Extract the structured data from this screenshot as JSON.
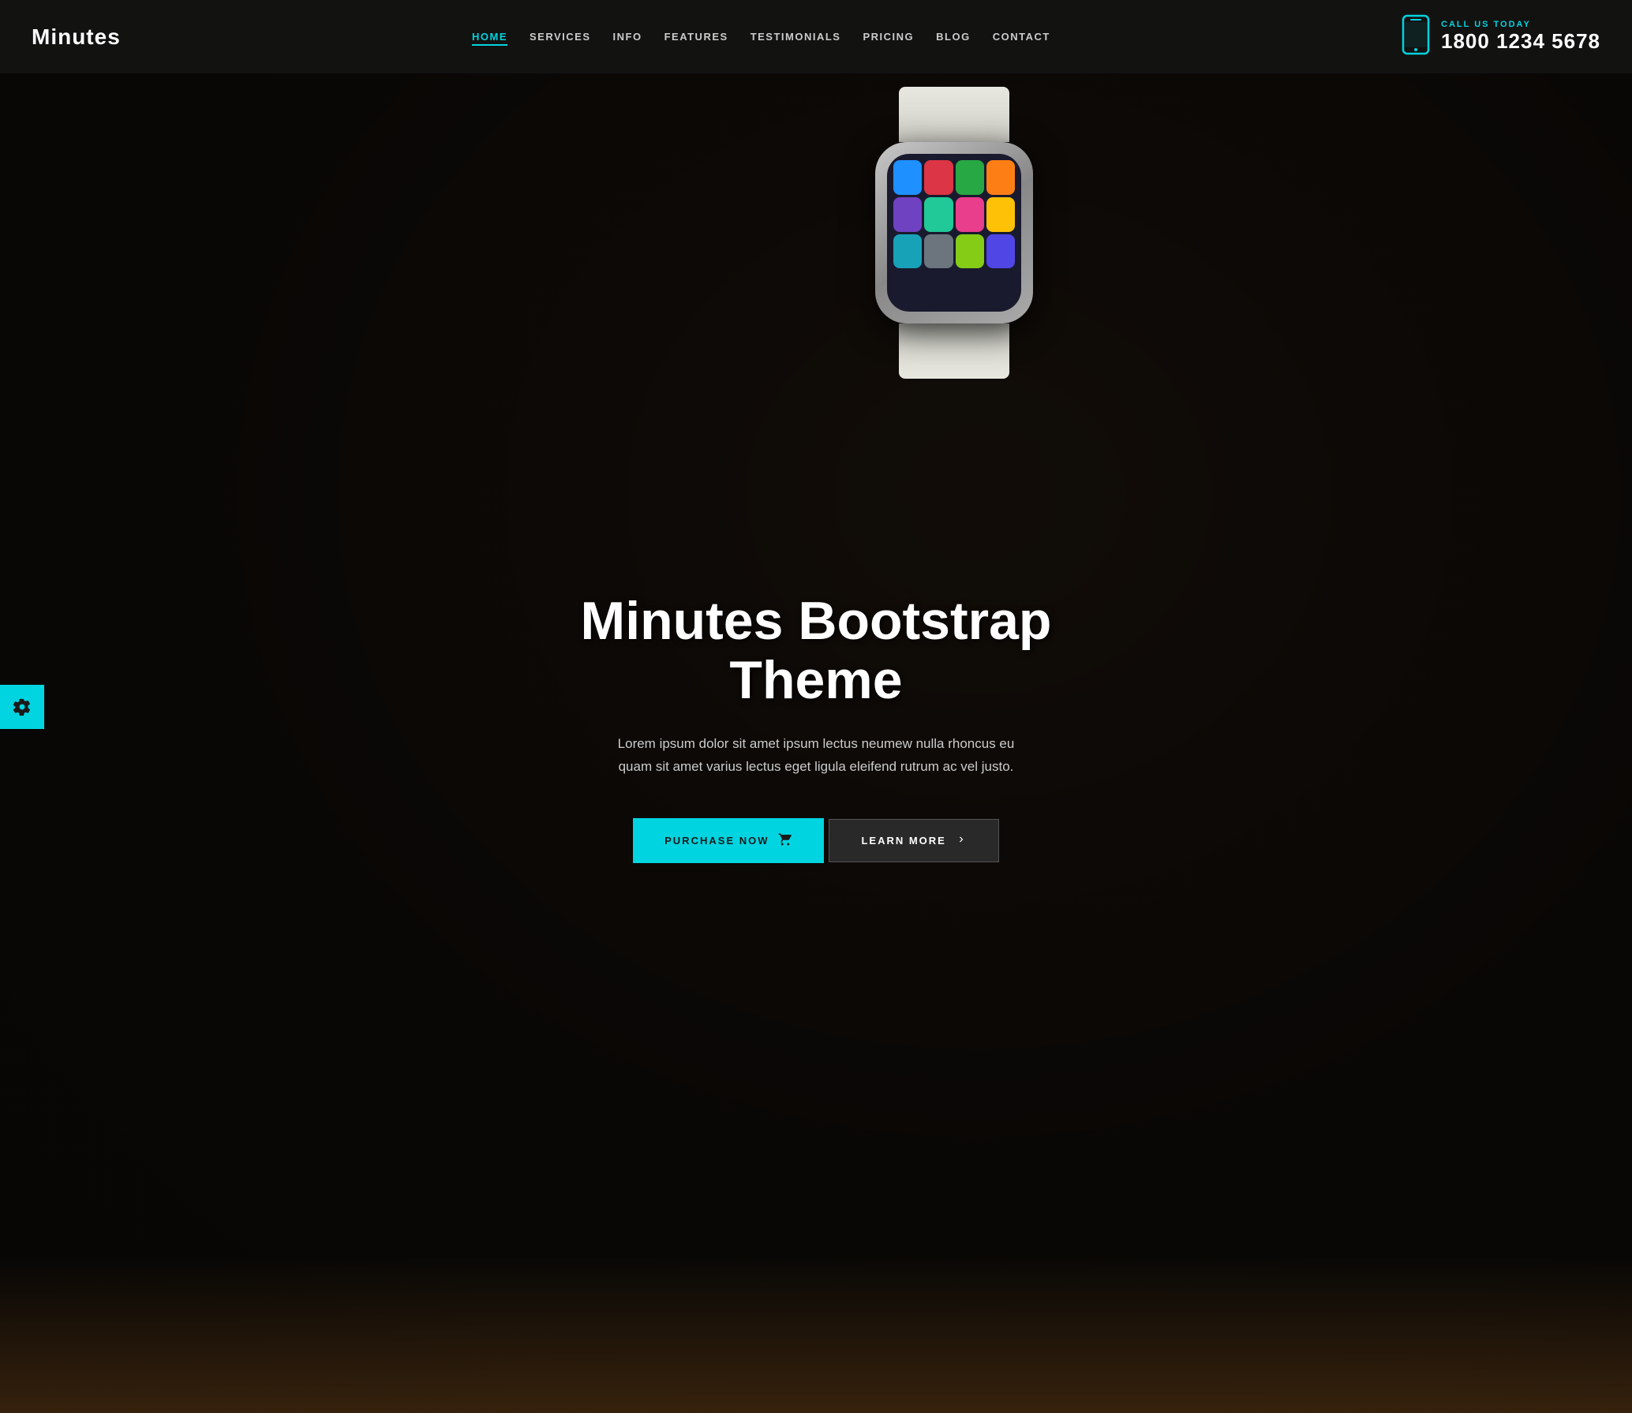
{
  "brand": {
    "name": "Minutes"
  },
  "navbar": {
    "links": [
      {
        "label": "HOME",
        "active": true
      },
      {
        "label": "SERVICES",
        "active": false
      },
      {
        "label": "INFO",
        "active": false
      },
      {
        "label": "FEATURES",
        "active": false
      },
      {
        "label": "TESTIMONIALS",
        "active": false
      },
      {
        "label": "PRICING",
        "active": false
      },
      {
        "label": "BLOG",
        "active": false
      },
      {
        "label": "CONTACT",
        "active": false
      }
    ]
  },
  "contact": {
    "label": "CALL US TODAY",
    "phone": "1800 1234 5678"
  },
  "hero": {
    "title": "Minutes Bootstrap Theme",
    "description": "Lorem ipsum dolor sit amet ipsum lectus neumew nulla rhoncus eu quam sit amet varius lectus eget ligula eleifend rutrum ac vel justo.",
    "btn_purchase": "PURCHASE NOW",
    "btn_learn": "LEARN MORE"
  },
  "settings": {
    "icon": "gear"
  },
  "colors": {
    "accent": "#00d4e0",
    "dark": "#1a1a1a",
    "white": "#ffffff"
  }
}
